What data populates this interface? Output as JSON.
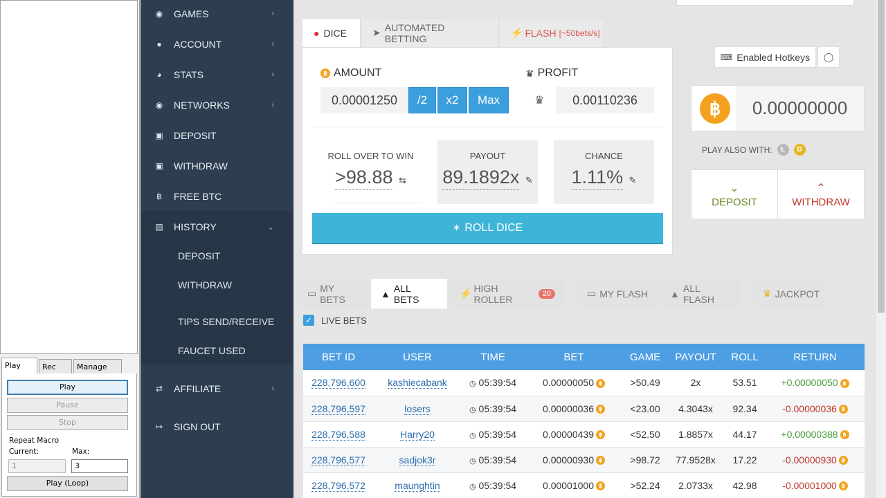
{
  "macro": {
    "tabs": [
      "Play",
      "Rec",
      "Manage"
    ],
    "buttons": {
      "play": "Play",
      "pause": "Pause",
      "stop": "Stop",
      "play_loop": "Play (Loop)"
    },
    "repeat_label": "Repeat Macro",
    "current_label": "Current:",
    "max_label": "Max:",
    "current_value": "1",
    "max_value": "3"
  },
  "nav": {
    "items": [
      {
        "label": "GAMES",
        "icon": "gamepad-icon"
      },
      {
        "label": "ACCOUNT",
        "icon": "user-icon"
      },
      {
        "label": "STATS",
        "icon": "pie-chart-icon"
      },
      {
        "label": "NETWORKS",
        "icon": "users-icon"
      },
      {
        "label": "DEPOSIT",
        "icon": "deposit-icon"
      },
      {
        "label": "WITHDRAW",
        "icon": "withdraw-icon"
      },
      {
        "label": "FREE BTC",
        "icon": "bitcoin-icon"
      },
      {
        "label": "HISTORY",
        "icon": "book-icon"
      },
      {
        "label": "AFFILIATE",
        "icon": "shuffle-icon"
      },
      {
        "label": "SIGN OUT",
        "icon": "sign-out-icon"
      }
    ],
    "history_sub": [
      "DEPOSIT",
      "WITHDRAW",
      "TIPS SEND/RECEIVE",
      "FAUCET USED"
    ]
  },
  "game_tabs": {
    "dice": "DICE",
    "automated": "AUTOMATED BETTING",
    "flash": "FLASH",
    "flash_rate": "[~50bets/s]"
  },
  "dice": {
    "amount_label": "AMOUNT",
    "profit_label": "PROFIT",
    "amount_value": "0.00001250",
    "profit_value": "0.00110236",
    "half_label": "/2",
    "double_label": "x2",
    "max_label": "Max",
    "roll_over_label": "ROLL OVER TO WIN",
    "roll_over_value": ">98.88",
    "payout_label": "PAYOUT",
    "payout_value": "89.1892x",
    "chance_label": "CHANCE",
    "chance_value": "1.11%",
    "roll_button": "ROLL DICE"
  },
  "side": {
    "hotkeys": "Enabled Hotkeys",
    "balance": "0.00000000",
    "play_also": "PLAY ALSO WITH:",
    "deposit": "DEPOSIT",
    "withdraw": "WITHDRAW",
    "colors": {
      "deposit": "#6a8a2a",
      "withdraw": "#c0392b",
      "btc": "#f4a21d"
    }
  },
  "bet_tabs": {
    "my_bets": "MY BETS",
    "all_bets": "ALL BETS",
    "high_roller": "HIGH ROLLER",
    "high_roller_count": "20",
    "my_flash": "MY FLASH",
    "all_flash": "ALL FLASH",
    "jackpot": "JACKPOT",
    "live_bets": "LIVE BETS"
  },
  "table": {
    "headers": [
      "BET ID",
      "USER",
      "TIME",
      "BET",
      "GAME",
      "PAYOUT",
      "ROLL",
      "RETURN"
    ],
    "rows": [
      {
        "id": "228,796,600",
        "user": "kashiecabank",
        "time": "05:39:54",
        "bet": "0.00000050",
        "game": ">50.49",
        "payout": "2x",
        "roll": "53.51",
        "ret": "+0.00000050",
        "win": true
      },
      {
        "id": "228,796,597",
        "user": "losers",
        "time": "05:39:54",
        "bet": "0.00000036",
        "game": "<23.00",
        "payout": "4.3043x",
        "roll": "92.34",
        "ret": "-0.00000036",
        "win": false
      },
      {
        "id": "228,796,588",
        "user": "Harry20",
        "time": "05:39:54",
        "bet": "0.00000439",
        "game": "<52.50",
        "payout": "1.8857x",
        "roll": "44.17",
        "ret": "+0.00000388",
        "win": true
      },
      {
        "id": "228,796,577",
        "user": "sadjok3r",
        "time": "05:39:54",
        "bet": "0.00000930",
        "game": ">98.72",
        "payout": "77.9528x",
        "roll": "17.22",
        "ret": "-0.00000930",
        "win": false
      },
      {
        "id": "228,796,572",
        "user": "maunghtin",
        "time": "05:39:54",
        "bet": "0.00001000",
        "game": ">52.24",
        "payout": "2.0733x",
        "roll": "42.98",
        "ret": "-0.00001000",
        "win": false
      }
    ]
  }
}
